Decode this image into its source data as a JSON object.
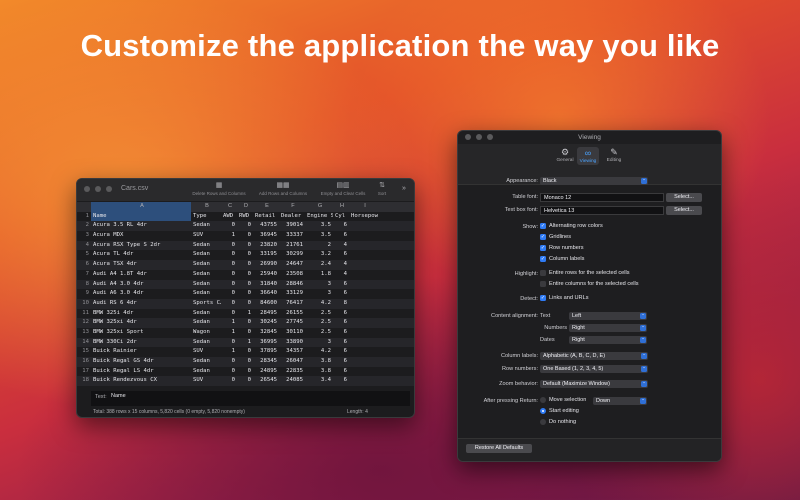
{
  "headline": "Customize the application the way you like",
  "sheet": {
    "title": "Cars.csv",
    "toolbar": {
      "delete_label": "Delete Rows and Columns",
      "add_label": "Add Rows and Columns",
      "empty_label": "Empty and Clear Cells",
      "sort_label": "Sort",
      "delete_icon": "grid-minus-icon",
      "add_icon": "grid-plus-icon",
      "empty_icon": "clear-cells-icon",
      "sort_icon": "sort-icon"
    },
    "column_letters": [
      "A",
      "B",
      "C",
      "D",
      "E",
      "F",
      "G",
      "H",
      "I"
    ],
    "rows": [
      [
        "1",
        "Name",
        "Type",
        "AWD",
        "RWD",
        "Retail P…",
        "Dealer Co…",
        "Engine Size…",
        "Cyl",
        "Horsepow"
      ],
      [
        "2",
        "Acura 3.5 RL 4dr",
        "Sedan",
        "0",
        "0",
        "43755",
        "39014",
        "3.5",
        "6",
        ""
      ],
      [
        "3",
        "Acura MDX",
        "SUV",
        "1",
        "0",
        "36945",
        "33337",
        "3.5",
        "6",
        ""
      ],
      [
        "4",
        "Acura RSX Type S 2dr",
        "Sedan",
        "0",
        "0",
        "23820",
        "21761",
        "2",
        "4",
        ""
      ],
      [
        "5",
        "Acura TL 4dr",
        "Sedan",
        "0",
        "0",
        "33195",
        "30299",
        "3.2",
        "6",
        ""
      ],
      [
        "6",
        "Acura TSX 4dr",
        "Sedan",
        "0",
        "0",
        "26990",
        "24647",
        "2.4",
        "4",
        ""
      ],
      [
        "7",
        "Audi A4 1.8T 4dr",
        "Sedan",
        "0",
        "0",
        "25940",
        "23508",
        "1.8",
        "4",
        ""
      ],
      [
        "8",
        "Audi A4 3.0 4dr",
        "Sedan",
        "0",
        "0",
        "31840",
        "28846",
        "3",
        "6",
        ""
      ],
      [
        "9",
        "Audi A6 3.0 4dr",
        "Sedan",
        "0",
        "0",
        "36640",
        "33129",
        "3",
        "6",
        ""
      ],
      [
        "10",
        "Audi RS 6 4dr",
        "Sports C…",
        "0",
        "0",
        "84600",
        "76417",
        "4.2",
        "8",
        ""
      ],
      [
        "11",
        "BMW 325i 4dr",
        "Sedan",
        "0",
        "1",
        "28495",
        "26155",
        "2.5",
        "6",
        ""
      ],
      [
        "12",
        "BMW 325xi 4dr",
        "Sedan",
        "1",
        "0",
        "30245",
        "27745",
        "2.5",
        "6",
        ""
      ],
      [
        "13",
        "BMW 325xi Sport",
        "Wagon",
        "1",
        "0",
        "32845",
        "30110",
        "2.5",
        "6",
        ""
      ],
      [
        "14",
        "BMW 330Ci 2dr",
        "Sedan",
        "0",
        "1",
        "36995",
        "33890",
        "3",
        "6",
        ""
      ],
      [
        "15",
        "Buick Rainier",
        "SUV",
        "1",
        "0",
        "37895",
        "34357",
        "4.2",
        "6",
        ""
      ],
      [
        "16",
        "Buick Regal GS 4dr",
        "Sedan",
        "0",
        "0",
        "28345",
        "26047",
        "3.8",
        "6",
        ""
      ],
      [
        "17",
        "Buick Regal LS 4dr",
        "Sedan",
        "0",
        "0",
        "24895",
        "22835",
        "3.8",
        "6",
        ""
      ],
      [
        "18",
        "Buick Rendezvous CX",
        "SUV",
        "0",
        "0",
        "26545",
        "24085",
        "3.4",
        "6",
        ""
      ]
    ],
    "edit_label": "Text:",
    "edit_value": "Name",
    "status_total": "Total:  388 rows x 15 columns, 5,820 cells (0 empty, 5,820 nonempty)",
    "status_length": "Length: 4"
  },
  "settings": {
    "title": "Viewing",
    "tabs": [
      {
        "label": "General",
        "icon": "gear-icon"
      },
      {
        "label": "Viewing",
        "icon": "glasses-icon"
      },
      {
        "label": "Editing",
        "icon": "pencil-square-icon"
      }
    ],
    "appearance_label": "Appearance:",
    "appearance_value": "Black",
    "table_font_label": "Table font:",
    "table_font_value": "Monaco  12",
    "text_box_font_label": "Text box font:",
    "text_box_font_value": "Helvetica 13",
    "select_label": "Select...",
    "show_label": "Show:",
    "show_options": [
      "Alternating row colors",
      "Gridlines",
      "Row numbers",
      "Column labels"
    ],
    "highlight_label": "Highlight:",
    "highlight_options": [
      "Entire rows for the selected cells",
      "Entire columns for the selected cells"
    ],
    "detect_label": "Detect:",
    "detect_option": "Links and URLs",
    "content_alignment_label": "Content alignment:",
    "alignment_text_label": "Text",
    "alignment_text_value": "Left",
    "alignment_numbers_label": "Numbers",
    "alignment_numbers_value": "Right",
    "alignment_dates_label": "Dates",
    "alignment_dates_value": "Right",
    "column_labels_label": "Column labels:",
    "column_labels_value": "Alphabetic (A, B, C, D, E)",
    "row_numbers_label": "Row numbers:",
    "row_numbers_value": "One Based (1, 2, 3, 4, 5)",
    "zoom_label": "Zoom behavior:",
    "zoom_value": "Default (Maximize Window)",
    "after_return_label": "After pressing Return:",
    "after_return_options": [
      "Move selection",
      "Start editing",
      "Do nothing"
    ],
    "move_direction_value": "Down",
    "restore_label": "Restore All Defaults"
  }
}
